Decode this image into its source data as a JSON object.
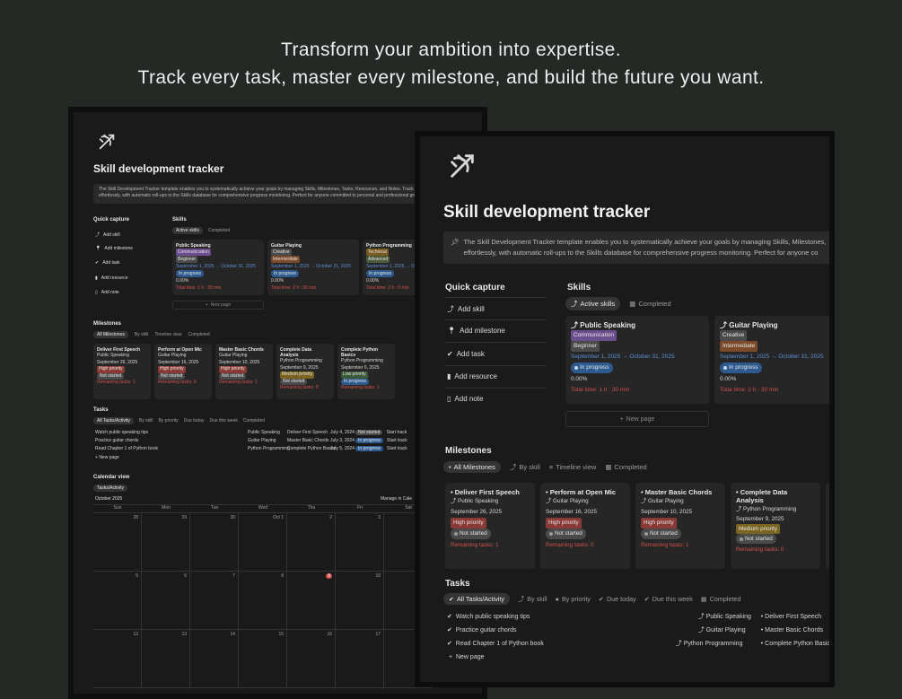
{
  "hero": {
    "line1": "Transform your ambition into expertise.",
    "line2": "Track every task, master every milestone, and build the future you want."
  },
  "app": {
    "logo_icon": "bow-arrow-icon",
    "title": "Skill development tracker",
    "callout_icon": "pin-icon",
    "callout_line1": "The Skill Development Tracker template enables you to systematically achieve your goals by managing Skills, Milestones, Tasks, Resources, and Notes. Track time",
    "callout_line2": "effortlessly, with automatic roll-ups to the Skills database for comprehensive progress monitoring. Perfect for anyone committed to personal and professional growth.",
    "callout_b_line1": "The Skill Development Tracker template enables you to systematically achieve your goals by managing Skills, Milestones,",
    "callout_b_line2": "effortlessly, with automatic roll-ups to the Skills database for comprehensive progress monitoring. Perfect for anyone co"
  },
  "quick_capture": {
    "title": "Quick capture",
    "items": [
      {
        "label": "Add skill",
        "icon": "bow-arrow-icon"
      },
      {
        "label": "Add milestone",
        "icon": "pin-icon"
      },
      {
        "label": "Add task",
        "icon": "check-circle-icon"
      },
      {
        "label": "Add resource",
        "icon": "bookmark-icon"
      },
      {
        "label": "Add note",
        "icon": "document-icon"
      }
    ]
  },
  "skills": {
    "title": "Skills",
    "tabs": [
      "Active skills",
      "Completed"
    ],
    "new_page": "New page",
    "cards": [
      {
        "name": "Public Speaking",
        "category": "Communication",
        "category_color": "#6b4e8e",
        "level": "Beginner",
        "level_color": "#4a4a4a",
        "dates": "September 1, 2025 → October 31, 2025",
        "status": "In progress",
        "progress": "0.00%",
        "total": "Total time: 1 h : 30 min"
      },
      {
        "name": "Guitar Playing",
        "category": "Creative",
        "category_color": "#4a4a4a",
        "level": "Intermediate",
        "level_color": "#7a4a2a",
        "dates": "September 1, 2025 → October 31, 2025",
        "status": "In progress",
        "progress": "0.00%",
        "total": "Total time: 2 h : 30 min"
      },
      {
        "name": "Python Programming",
        "category": "Technical",
        "category_color": "#7a5a20",
        "level": "Advanced",
        "level_color": "#4a5a3a",
        "dates": "September 1, 2025 → October 31, 2025",
        "status": "In progress",
        "progress": "0.00%",
        "total": "Total time: 2 h : 0 min"
      }
    ]
  },
  "milestones": {
    "title": "Milestones",
    "tabs": [
      "All Milestones",
      "By skill",
      "Timeline view",
      "Completed"
    ],
    "cards": [
      {
        "name": "Deliver First Speech",
        "skill": "Public Speaking",
        "date": "September 26, 2025",
        "priority": "High priority",
        "priority_color": "#8a3a36",
        "status": "Not started",
        "remaining": "Remaining tasks: 1"
      },
      {
        "name": "Perform at Open Mic",
        "skill": "Guitar Playing",
        "date": "September 16, 2025",
        "priority": "High priority",
        "priority_color": "#8a3a36",
        "status": "Not started",
        "remaining": "Remaining tasks: 0"
      },
      {
        "name": "Master Basic Chords",
        "skill": "Guitar Playing",
        "date": "September 10, 2025",
        "priority": "High priority",
        "priority_color": "#8a3a36",
        "status": "Not started",
        "remaining": "Remaining tasks: 1"
      },
      {
        "name": "Complete Data Analysis",
        "skill": "Python Programming",
        "date": "September 9, 2025",
        "priority": "Medium priority",
        "priority_color": "#7a6420",
        "status": "Not started",
        "remaining": "Remaining tasks: 0"
      },
      {
        "name": "Complete Python Basics",
        "skill": "Python Programming",
        "date": "September 6, 2025",
        "priority": "Low priority",
        "priority_color": "#3a5a3a",
        "status": "In progress",
        "remaining": "Remaining tasks: 1"
      }
    ]
  },
  "tasks": {
    "title": "Tasks",
    "tabs": [
      "All Tasks/Activity",
      "By skill",
      "By priority",
      "Due today",
      "Due this week",
      "Completed"
    ],
    "new_page": "New page",
    "rows": [
      {
        "name": "Watch public speaking tips",
        "skill": "Public Speaking",
        "milestone": "Deliver First Speech",
        "date": "July 4, 2024",
        "status": "Not started",
        "extra": "Start track"
      },
      {
        "name": "Practice guitar chords",
        "skill": "Guitar Playing",
        "milestone": "Master Basic Chords",
        "date": "July 3, 2024",
        "status": "In progress",
        "extra": "Start track"
      },
      {
        "name": "Read Chapter 1 of Python book",
        "skill": "Python Programming",
        "milestone": "Complete Python Basics",
        "date": "July 5, 2024",
        "status": "In progress",
        "extra": "Start track"
      }
    ]
  },
  "calendar": {
    "title": "Calendar view",
    "tab": "Tasks/Activity",
    "month": "October 2025",
    "manage": "Manage in Cale",
    "weekdays": [
      "Sun",
      "Mon",
      "Tue",
      "Wed",
      "Thu",
      "Fri",
      "Sat"
    ],
    "week1": [
      "28",
      "29",
      "30",
      "Oct 1",
      "2",
      "3",
      "4"
    ],
    "week2": [
      "5",
      "6",
      "7",
      "8",
      "9",
      "10",
      "11"
    ],
    "week3": [
      "12",
      "13",
      "14",
      "15",
      "16",
      "17",
      "18"
    ],
    "today": "9"
  },
  "colors": {
    "page_bg": "#252925",
    "window_bg": "#1a1a1a",
    "card_bg": "#262626",
    "link_blue": "#5b8fd6",
    "alert_red": "#d2524e",
    "status_blue": "#2d5a8e"
  }
}
